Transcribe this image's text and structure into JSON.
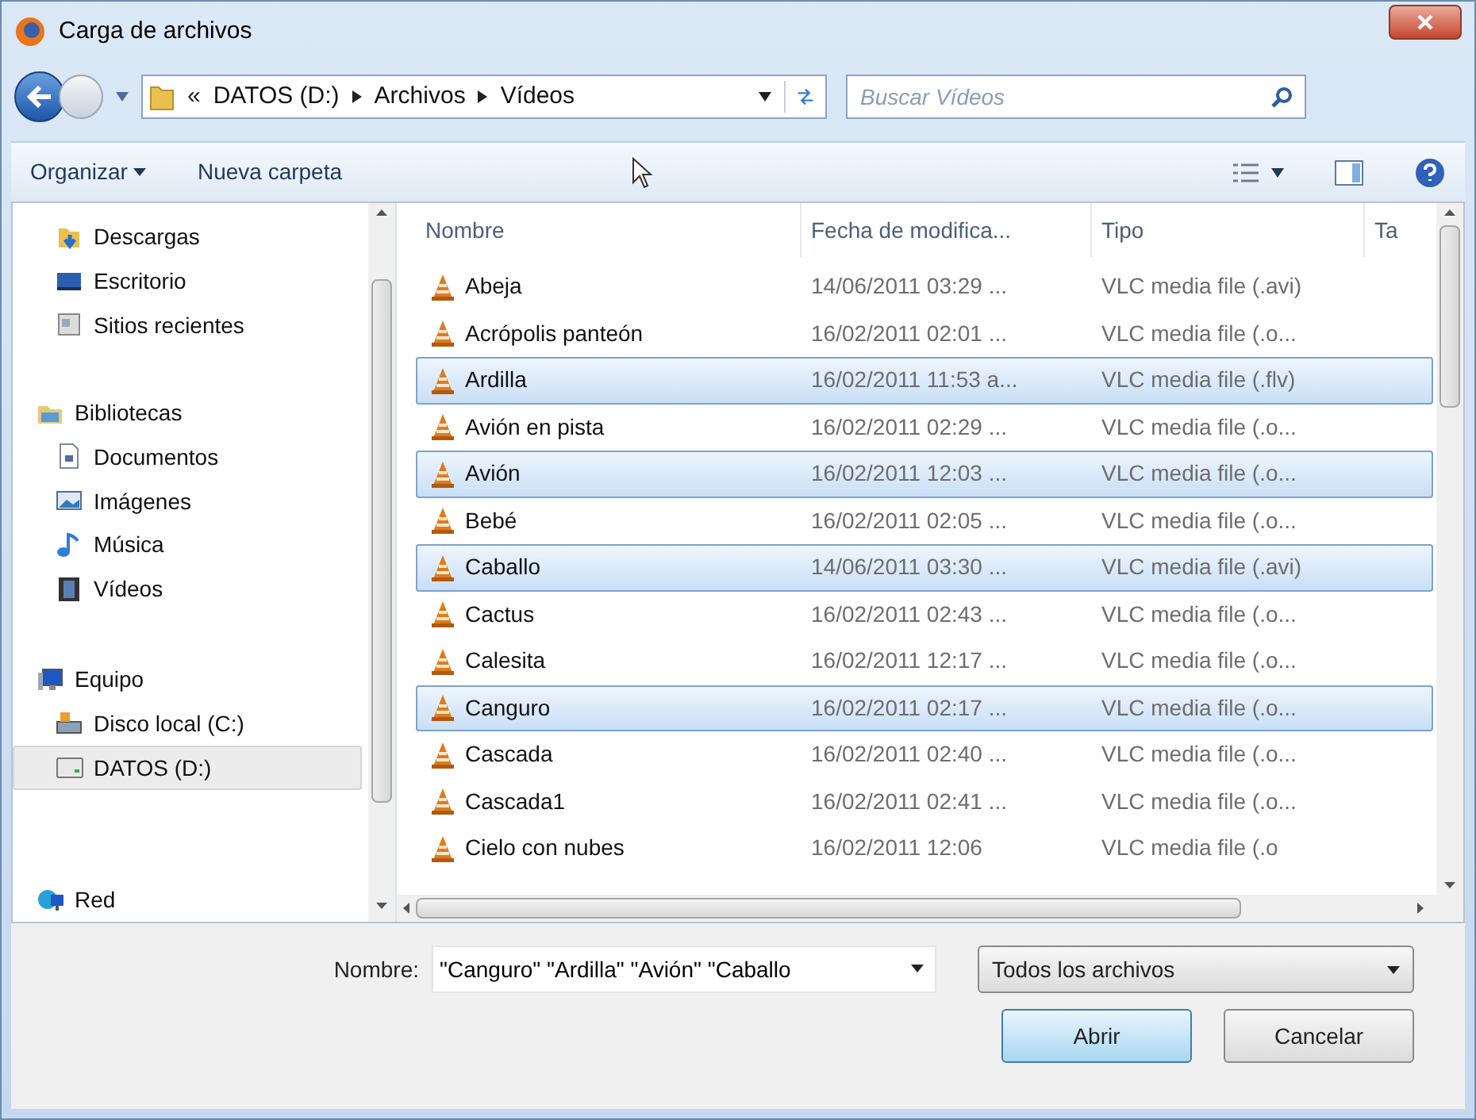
{
  "window": {
    "title": "Carga de archivos"
  },
  "address_bar": {
    "overflow": "«",
    "crumbs": [
      "DATOS (D:)",
      "Archivos",
      "Vídeos"
    ]
  },
  "search": {
    "placeholder": "Buscar Vídeos"
  },
  "toolbar": {
    "organize": "Organizar",
    "new_folder": "Nueva carpeta"
  },
  "sidebar": {
    "items": [
      {
        "label": "Descargas",
        "selected": false,
        "kind": "indented"
      },
      {
        "label": "Escritorio",
        "selected": false,
        "kind": "indented"
      },
      {
        "label": "Sitios recientes",
        "selected": false,
        "kind": "indented"
      },
      {
        "label": "Bibliotecas",
        "selected": false,
        "kind": "group",
        "children": [
          {
            "label": "Documentos",
            "selected": false
          },
          {
            "label": "Imágenes",
            "selected": false
          },
          {
            "label": "Música",
            "selected": false
          },
          {
            "label": "Vídeos",
            "selected": false
          }
        ]
      },
      {
        "label": "Equipo",
        "selected": false,
        "kind": "group",
        "children": [
          {
            "label": "Disco local (C:)",
            "selected": false
          },
          {
            "label": "DATOS (D:)",
            "selected": true
          }
        ]
      },
      {
        "label": "Red",
        "selected": false,
        "kind": "group"
      }
    ]
  },
  "table": {
    "columns": [
      "Nombre",
      "Fecha de modifica...",
      "Tipo",
      "Ta"
    ],
    "rows": [
      {
        "name": "Abeja",
        "date": "14/06/2011 03:29 ...",
        "type": "VLC media file (.avi)",
        "selected": false
      },
      {
        "name": "Acrópolis panteón",
        "date": "16/02/2011 02:01 ...",
        "type": "VLC media file (.o...",
        "selected": false
      },
      {
        "name": "Ardilla",
        "date": "16/02/2011 11:53 a...",
        "type": "VLC media file (.flv)",
        "selected": true
      },
      {
        "name": "Avión en pista",
        "date": "16/02/2011 02:29 ...",
        "type": "VLC media file (.o...",
        "selected": false
      },
      {
        "name": "Avión",
        "date": "16/02/2011 12:03 ...",
        "type": "VLC media file (.o...",
        "selected": true
      },
      {
        "name": "Bebé",
        "date": "16/02/2011 02:05 ...",
        "type": "VLC media file (.o...",
        "selected": false
      },
      {
        "name": "Caballo",
        "date": "14/06/2011 03:30 ...",
        "type": "VLC media file (.avi)",
        "selected": true
      },
      {
        "name": "Cactus",
        "date": "16/02/2011 02:43 ...",
        "type": "VLC media file (.o...",
        "selected": false
      },
      {
        "name": "Calesita",
        "date": "16/02/2011 12:17 ...",
        "type": "VLC media file (.o...",
        "selected": false
      },
      {
        "name": "Canguro",
        "date": "16/02/2011 02:17 ...",
        "type": "VLC media file (.o...",
        "selected": true
      },
      {
        "name": "Cascada",
        "date": "16/02/2011 02:40 ...",
        "type": "VLC media file (.o...",
        "selected": false
      },
      {
        "name": "Cascada1",
        "date": "16/02/2011 02:41 ...",
        "type": "VLC media file (.o...",
        "selected": false
      },
      {
        "name": "Cielo con nubes",
        "date": "16/02/2011 12:06",
        "type": "VLC media file (.o",
        "selected": false
      }
    ]
  },
  "filename": {
    "label": "Nombre:",
    "value": "\"Canguro\" \"Ardilla\" \"Avión\" \"Caballo"
  },
  "filter": {
    "value": "Todos los archivos"
  },
  "buttons": [
    "Abrir",
    "Cancelar"
  ]
}
